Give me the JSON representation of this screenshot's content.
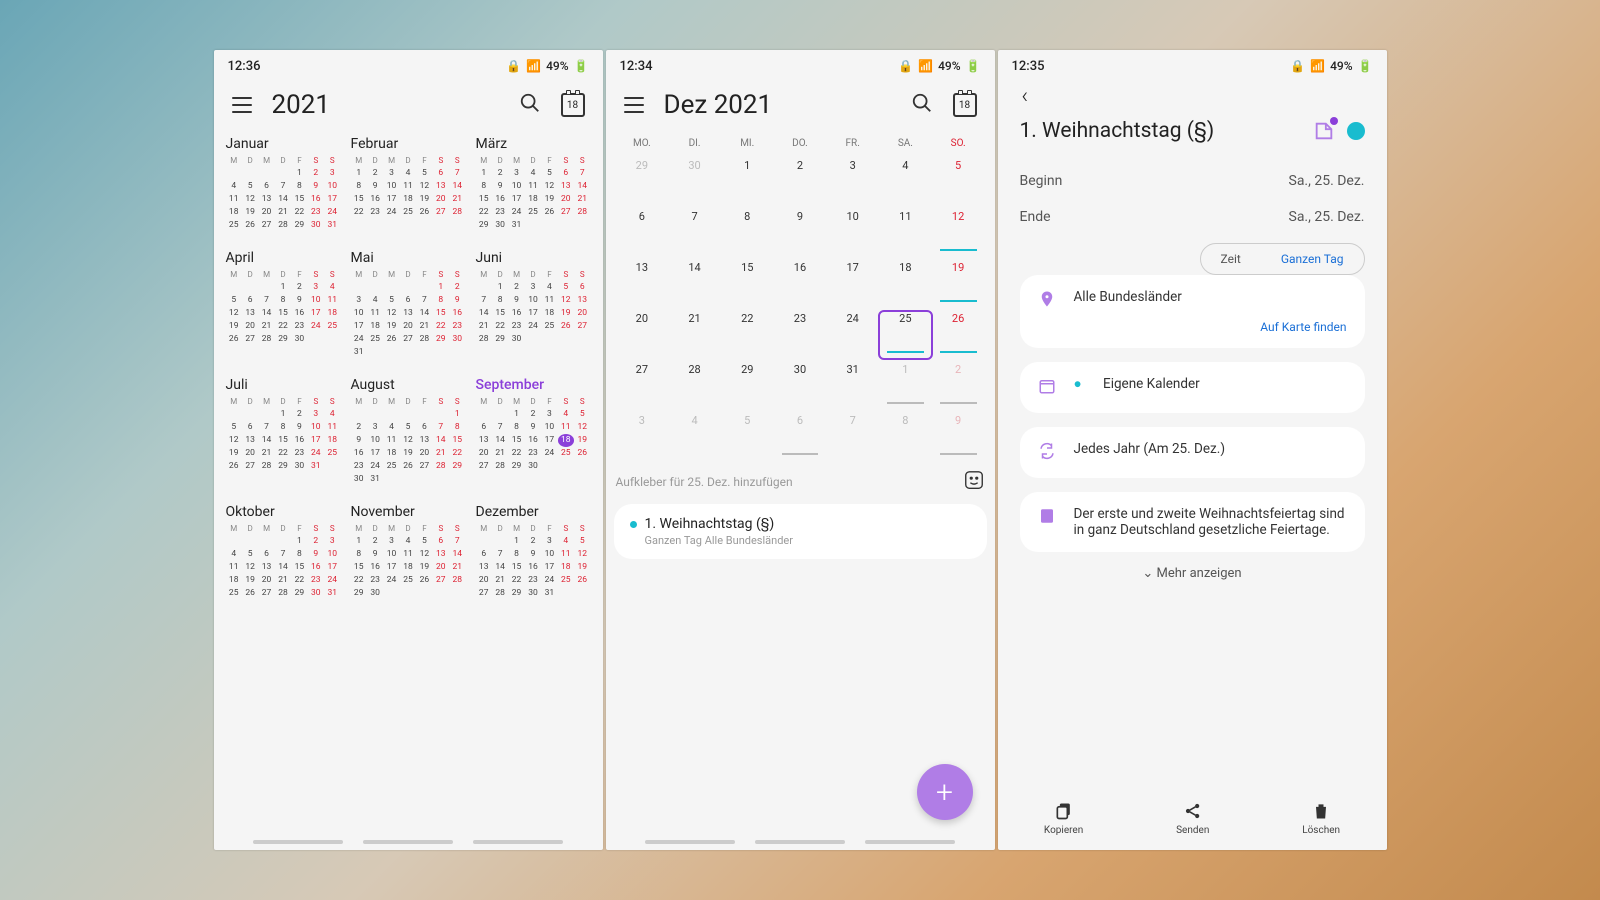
{
  "bg": "gradient",
  "phones": [
    {
      "status": {
        "time": "12:36",
        "battery": "49%",
        "icons": [
          "alarm",
          "download",
          "square",
          "dot",
          "lock",
          "wifi",
          "signal",
          "battery"
        ]
      },
      "appbar": {
        "title": "2021",
        "today": "18"
      },
      "highlightMonth": 8,
      "today": {
        "month": 8,
        "day": 18
      },
      "months": [
        {
          "name": "Januar",
          "start": 4,
          "days": 31,
          "prev": 0
        },
        {
          "name": "Februar",
          "start": 0,
          "days": 28,
          "prev": 0
        },
        {
          "name": "März",
          "start": 0,
          "days": 31,
          "prev": 0
        },
        {
          "name": "April",
          "start": 3,
          "days": 30,
          "prev": 0
        },
        {
          "name": "Mai",
          "start": 5,
          "days": 31,
          "prev": 0
        },
        {
          "name": "Juni",
          "start": 1,
          "days": 30,
          "prev": 0
        },
        {
          "name": "Juli",
          "start": 3,
          "days": 31,
          "prev": 0
        },
        {
          "name": "August",
          "start": 6,
          "days": 31,
          "prev": 0
        },
        {
          "name": "September",
          "start": 2,
          "days": 30,
          "prev": 0
        },
        {
          "name": "Oktober",
          "start": 4,
          "days": 31,
          "prev": 0
        },
        {
          "name": "November",
          "start": 0,
          "days": 30,
          "prev": 0
        },
        {
          "name": "Dezember",
          "start": 2,
          "days": 31,
          "prev": 0
        }
      ],
      "dowShort": [
        "M",
        "D",
        "M",
        "D",
        "F",
        "S",
        "S"
      ]
    },
    {
      "status": {
        "time": "12:34",
        "battery": "49%",
        "icons": [
          "download",
          "alarm",
          "square",
          "dot",
          "lock",
          "wifi",
          "signal",
          "battery"
        ]
      },
      "appbar": {
        "title": "Dez 2021",
        "today": "18"
      },
      "dow": [
        "MO.",
        "DI.",
        "MI.",
        "DO.",
        "FR.",
        "SA.",
        "SO."
      ],
      "grid": [
        [
          {
            "d": 29,
            "dim": true
          },
          {
            "d": 30,
            "dim": true
          },
          {
            "d": 1
          },
          {
            "d": 2
          },
          {
            "d": 3
          },
          {
            "d": 4
          },
          {
            "d": 5,
            "sun": true
          }
        ],
        [
          {
            "d": 6
          },
          {
            "d": 7
          },
          {
            "d": 8
          },
          {
            "d": 9
          },
          {
            "d": 10
          },
          {
            "d": 11
          },
          {
            "d": 12,
            "sun": true,
            "mark": true
          }
        ],
        [
          {
            "d": 13
          },
          {
            "d": 14
          },
          {
            "d": 15
          },
          {
            "d": 16
          },
          {
            "d": 17
          },
          {
            "d": 18
          },
          {
            "d": 19,
            "sun": true,
            "mark": true
          }
        ],
        [
          {
            "d": 20
          },
          {
            "d": 21
          },
          {
            "d": 22
          },
          {
            "d": 23
          },
          {
            "d": 24
          },
          {
            "d": 25,
            "sel": true,
            "mark": true
          },
          {
            "d": 26,
            "sun": true,
            "mark": true
          }
        ],
        [
          {
            "d": 27
          },
          {
            "d": 28
          },
          {
            "d": 29
          },
          {
            "d": 30
          },
          {
            "d": 31
          },
          {
            "d": 1,
            "dim": true,
            "markg": true
          },
          {
            "d": 2,
            "dim": true,
            "sun": true,
            "markg": true
          }
        ],
        [
          {
            "d": 3,
            "dim": true
          },
          {
            "d": 4,
            "dim": true
          },
          {
            "d": 5,
            "dim": true
          },
          {
            "d": 6,
            "dim": true,
            "markg": true
          },
          {
            "d": 7,
            "dim": true
          },
          {
            "d": 8,
            "dim": true
          },
          {
            "d": 9,
            "dim": true,
            "sun": true,
            "markg": true
          }
        ]
      ],
      "stickerHint": "Aufkleber für 25. Dez. hinzufügen",
      "event": {
        "title": "1. Weihnachtstag (§)",
        "sub": "Ganzen Tag   Alle Bundesländer"
      }
    },
    {
      "status": {
        "time": "12:35",
        "battery": "49%",
        "icons": [
          "download",
          "alarm",
          "square",
          "dot",
          "lock",
          "wifi",
          "signal",
          "battery"
        ]
      },
      "title": "1. Weihnachtstag (§)",
      "begin": {
        "label": "Beginn",
        "value": "Sa., 25. Dez."
      },
      "end": {
        "label": "Ende",
        "value": "Sa., 25. Dez."
      },
      "pill": {
        "time": "Zeit",
        "allday": "Ganzen Tag"
      },
      "location": "Alle Bundesländer",
      "mapLink": "Auf Karte finden",
      "calendar": "Eigene Kalender",
      "repeat": "Jedes Jahr (Am 25. Dez.)",
      "note": "Der erste und zweite Weihnachtsfeiertag sind in ganz Deutschland gesetzliche Feiertage.",
      "more": "Mehr anzeigen",
      "actions": {
        "copy": "Kopieren",
        "send": "Senden",
        "delete": "Löschen"
      }
    }
  ]
}
